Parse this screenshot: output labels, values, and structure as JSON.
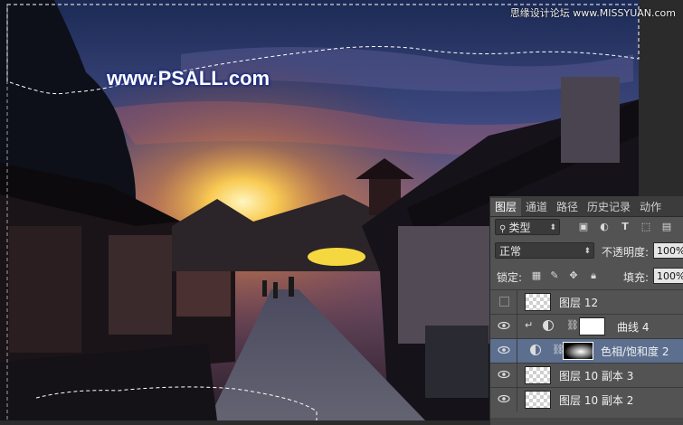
{
  "watermark_top": "思缘设计论坛 www.MISSYUAN.com",
  "watermark_site": "www.PSALL.com",
  "panel": {
    "tabs": [
      "图层",
      "通道",
      "路径",
      "历史记录",
      "动作"
    ],
    "active_tab": "图层",
    "filter_kind": "类型",
    "blend_mode": "正常",
    "opacity_label": "不透明度:",
    "opacity_value": "100%",
    "lock_label": "锁定:",
    "fill_label": "填充:",
    "fill_value": "100%",
    "layers": [
      {
        "name": "图层 12",
        "visible": false,
        "type": "pixel"
      },
      {
        "name": "曲线 4",
        "visible": true,
        "type": "curves",
        "clipped": true
      },
      {
        "name": "色相/饱和度 2",
        "visible": true,
        "type": "hue-saturation",
        "selected": true
      },
      {
        "name": "图层 10 副本 3",
        "visible": true,
        "type": "pixel"
      },
      {
        "name": "图层 10 副本 2",
        "visible": true,
        "type": "pixel"
      }
    ]
  }
}
